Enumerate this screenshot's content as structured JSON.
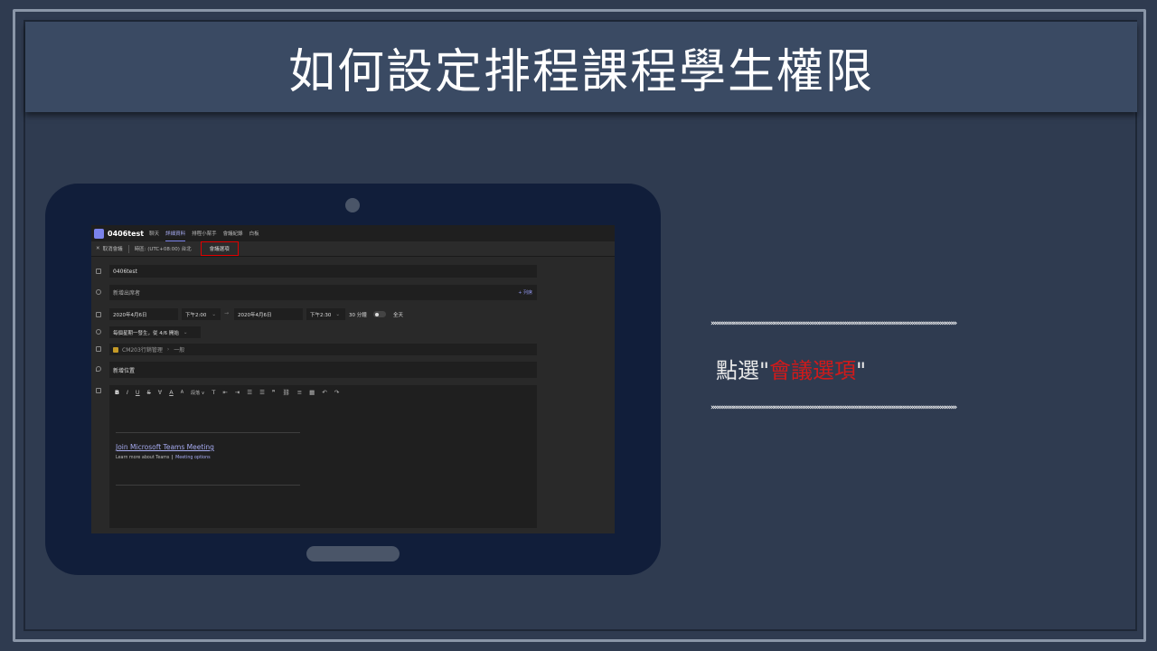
{
  "slide": {
    "title": "如何設定排程課程學生權限"
  },
  "teams": {
    "meeting_name": "0406test",
    "tabs": [
      {
        "label": "聊天",
        "active": false
      },
      {
        "label": "詳細資料",
        "active": true
      },
      {
        "label": "排程小幫手",
        "active": false
      },
      {
        "label": "會議紀錄",
        "active": false
      },
      {
        "label": "白板",
        "active": false
      }
    ],
    "toolbar": {
      "close": "✕",
      "cancel": "取消會議",
      "timezone": "時區: (UTC+08:00) 台北",
      "options": "會議選項"
    },
    "form": {
      "title": "0406test",
      "attendees_placeholder": "新增出席者",
      "optional": "+ 列席",
      "start_date": "2020年4月6日",
      "start_time": "下午2:00",
      "end_date": "2020年4月6日",
      "end_time": "下午2:30",
      "duration": "30 分鐘",
      "all_day": "全天",
      "recurrence": "每個星期一發生，從 4/6 開始",
      "channel": "CM203行銷管理",
      "channel_sub": "一般",
      "location_placeholder": "新增位置"
    },
    "editor": {
      "format_buttons": [
        "B",
        "I",
        "U",
        "S",
        "∀",
        "A",
        "A",
        "段落 ∨",
        "T",
        "⇤",
        "⇥",
        "☰",
        "☰",
        "❞",
        "⛓",
        "≡",
        "▦",
        "↶",
        "↷"
      ],
      "join_link": "Join Microsoft Teams Meeting",
      "learn_more": "Learn more about Teams",
      "separator": "|",
      "meeting_options": "Meeting options"
    }
  },
  "callout": {
    "chevrons": "»»»»»»»»»»»»»»»»»»»»»»»»»»»»»»»»»»»»»»»»»»»»»»»»»»»»»»»»»»»»»»»»»»",
    "prefix": "點選\"",
    "highlight": "會議選項",
    "suffix": "\""
  },
  "colors": {
    "background": "#2f3b50",
    "title_bar": "#3a4a63",
    "tablet": "#111e3a",
    "highlight_red": "#d11a1a",
    "teams_accent": "#7b83eb"
  }
}
